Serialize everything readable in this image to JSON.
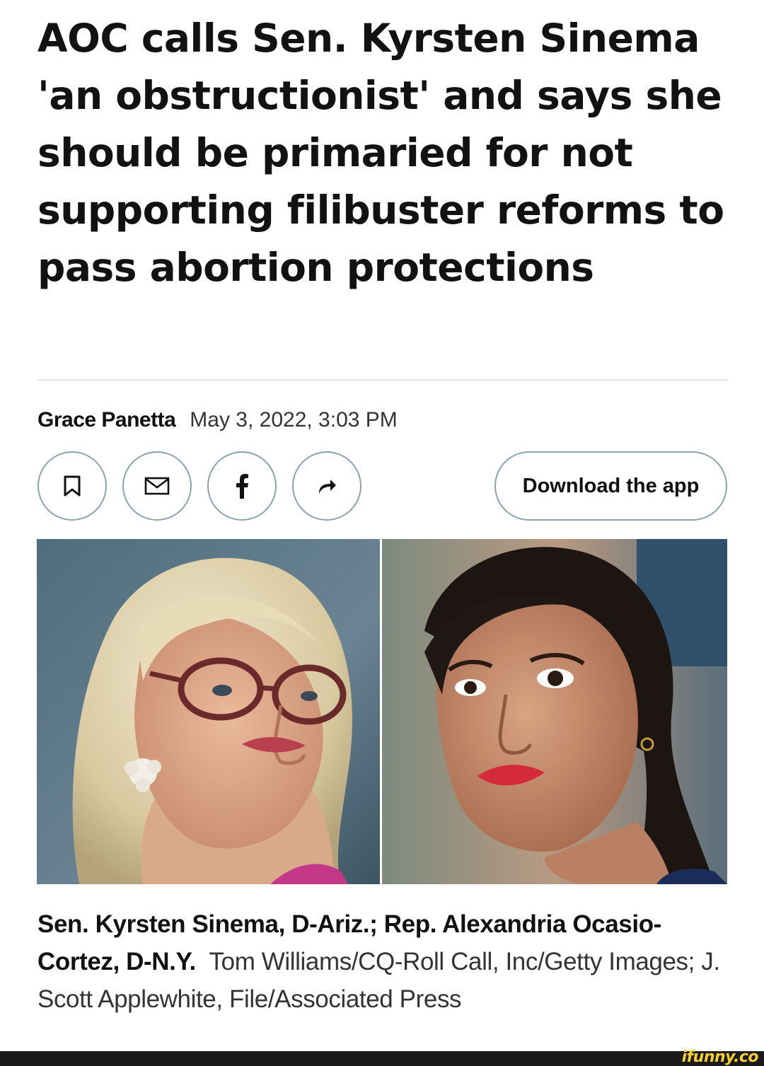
{
  "article": {
    "headline": "AOC calls Sen. Kyrsten Sinema 'an obstructionist' and says she should be primaried for not supporting filibuster reforms to pass abortion protections",
    "author": "Grace Panetta",
    "date": "May 3, 2022, 3:03 PM"
  },
  "actions": {
    "bookmark_icon": "bookmark-icon",
    "email_icon": "mail-icon",
    "facebook_icon": "facebook-icon",
    "share_icon": "share-icon",
    "download_app_label": "Download the app"
  },
  "caption": {
    "subjects": "Sen. Kyrsten Sinema, D-Ariz.; Rep. Alexandria Ocasio-Cortez, D-N.Y.",
    "credit": "Tom Williams/CQ-Roll Call, Inc/Getty Images; J. Scott Applewhite, File/Associated Press"
  },
  "watermark": "ifunny.co",
  "colors": {
    "button_border": "#8aa3ae",
    "divider": "#e4e4e4",
    "watermark": "#f6cf2e"
  }
}
